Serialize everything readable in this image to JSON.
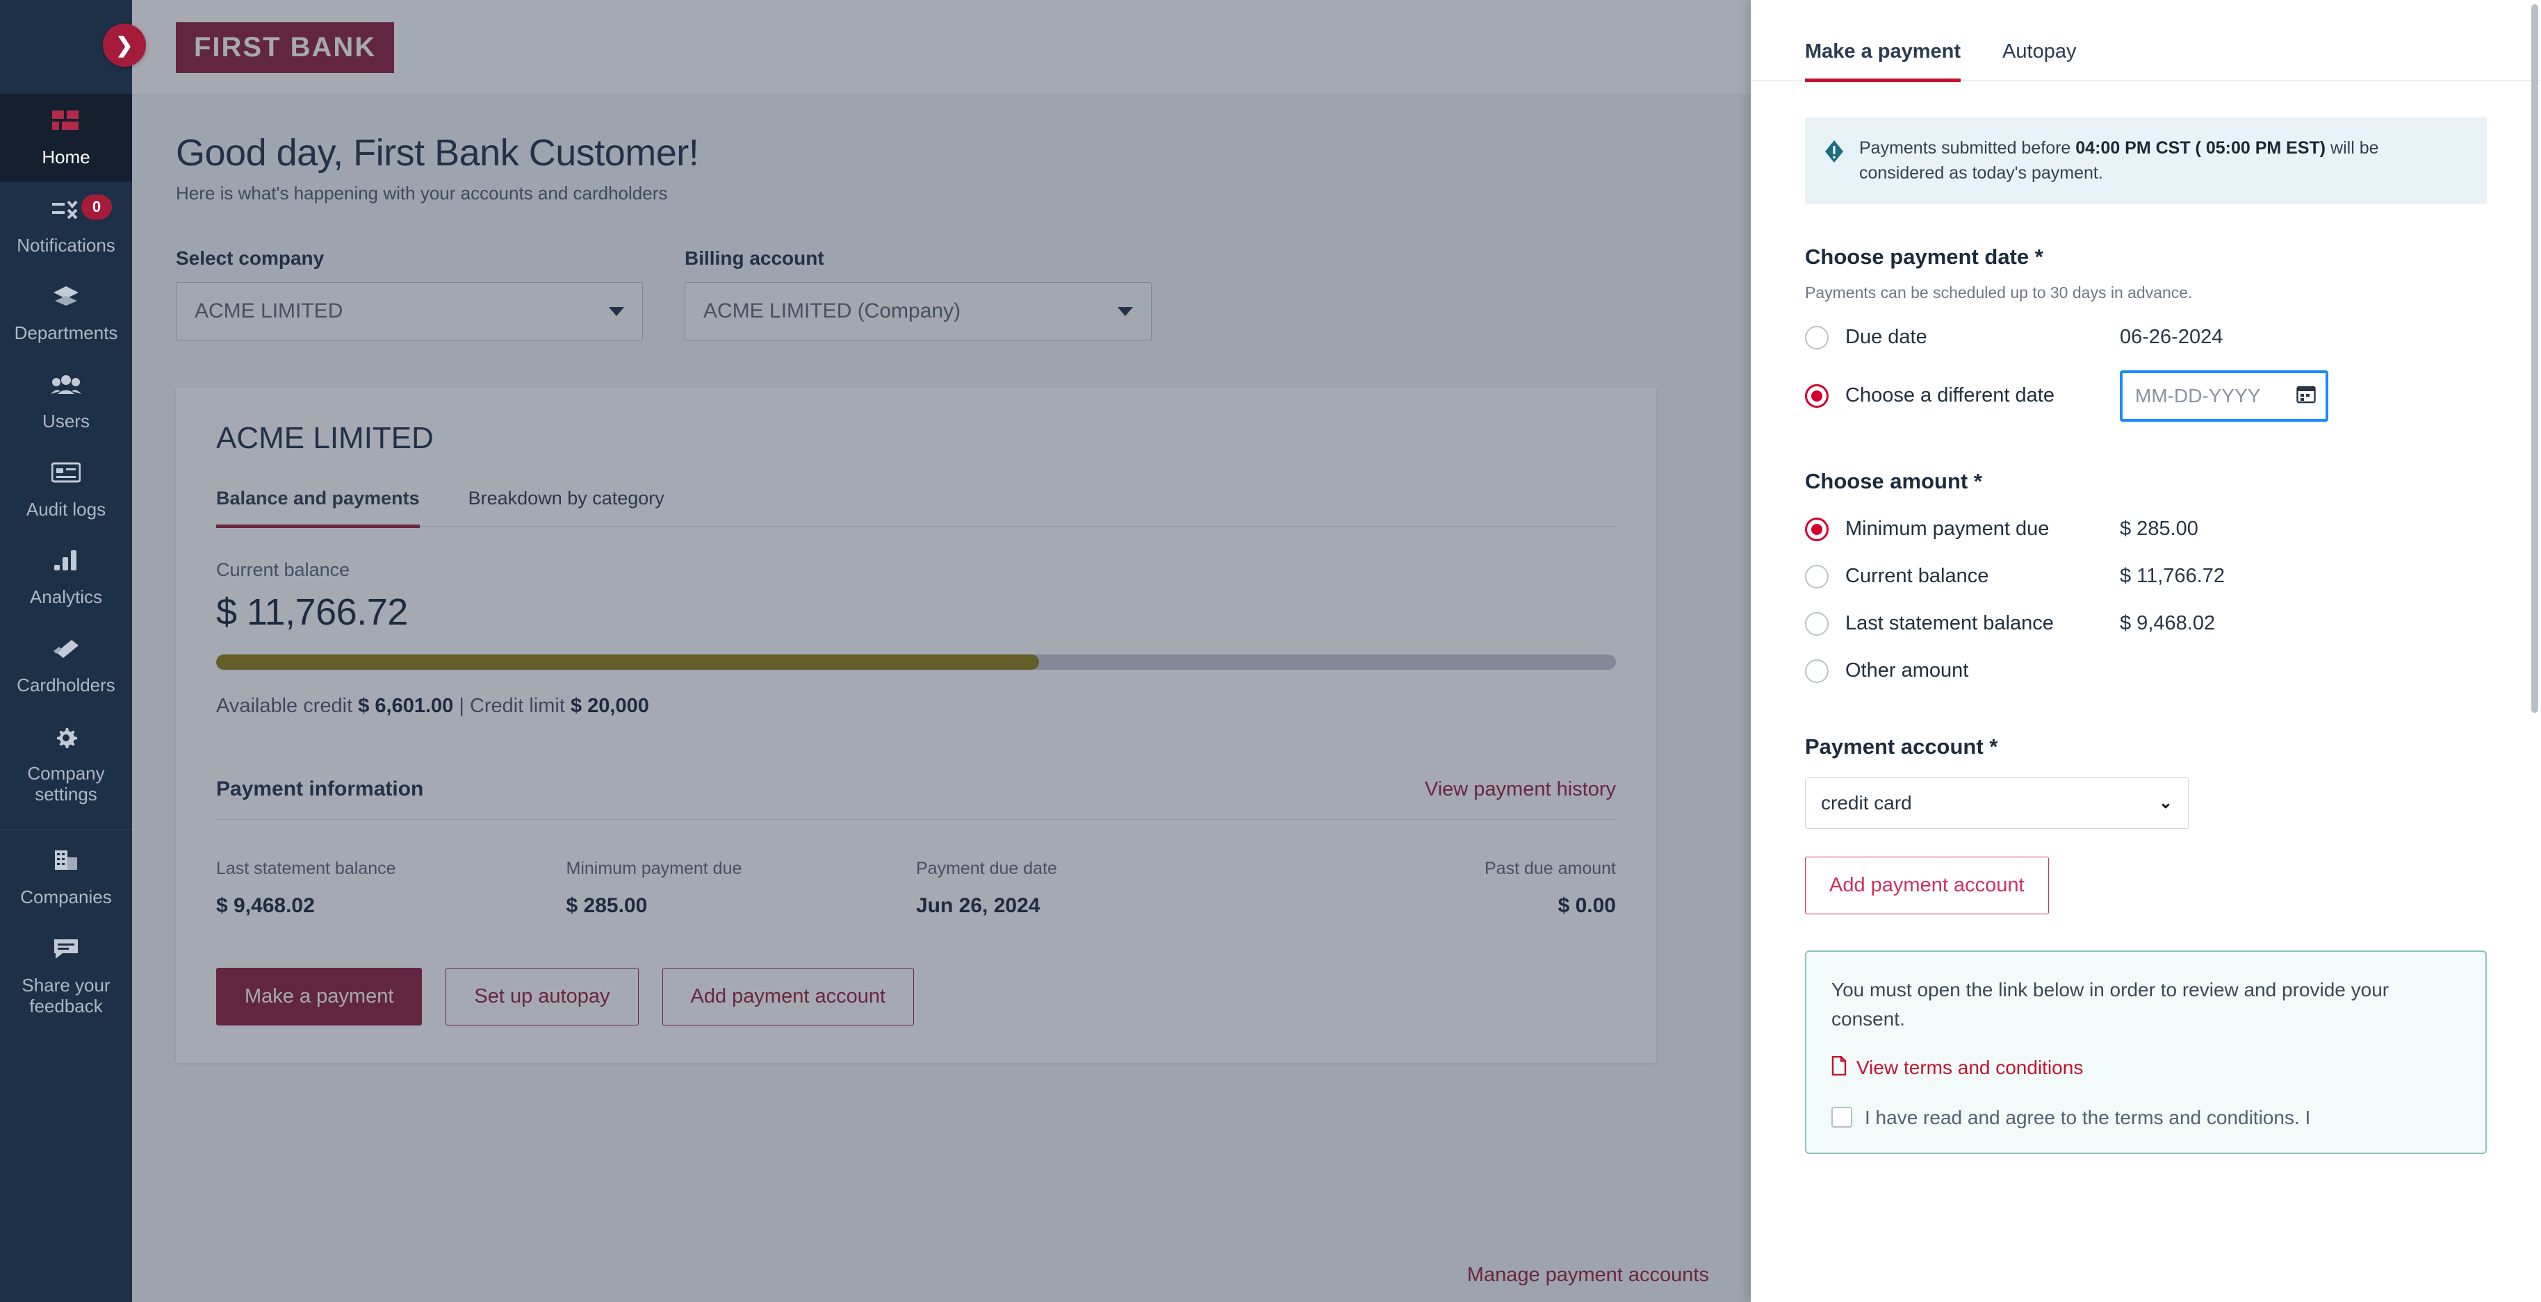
{
  "brand": {
    "logo_text": "FIRST BANK",
    "accent": "#8c1d3c",
    "panel_accent": "#c41230",
    "sidebar_bg": "#1e3048",
    "progress_fill": "#8e7a14"
  },
  "sidebar": {
    "toggle_icon": "chevron-right-icon",
    "items": [
      {
        "label": "Home",
        "icon": "dashboard-grid-icon",
        "active": true,
        "badge": null
      },
      {
        "label": "Notifications",
        "icon": "notifications-list-icon",
        "active": false,
        "badge": "0"
      },
      {
        "label": "Departments",
        "icon": "layers-icon",
        "active": false,
        "badge": null
      },
      {
        "label": "Users",
        "icon": "users-group-icon",
        "active": false,
        "badge": null
      },
      {
        "label": "Audit logs",
        "icon": "audit-log-icon",
        "active": false,
        "badge": null
      },
      {
        "label": "Analytics",
        "icon": "bar-chart-icon",
        "active": false,
        "badge": null
      },
      {
        "label": "Cardholders",
        "icon": "card-icon",
        "active": false,
        "badge": null
      },
      {
        "label": "Company settings",
        "icon": "gear-icon",
        "active": false,
        "badge": null
      },
      {
        "label": "Companies",
        "icon": "building-icon",
        "active": false,
        "badge": null
      },
      {
        "label": "Share your feedback",
        "icon": "feedback-chat-icon",
        "active": false,
        "badge": null
      }
    ]
  },
  "page": {
    "title": "Good day, First Bank Customer!",
    "subtitle": "Here is what's happening with your accounts and cardholders"
  },
  "selectors": {
    "company": {
      "label": "Select company",
      "value": "ACME LIMITED"
    },
    "billing": {
      "label": "Billing account",
      "value": "ACME LIMITED (Company)"
    }
  },
  "account_card": {
    "title": "ACME LIMITED",
    "tabs": [
      {
        "label": "Balance and payments",
        "active": true
      },
      {
        "label": "Breakdown by category",
        "active": false
      }
    ],
    "current_balance_label": "Current balance",
    "current_balance_value": "$ 11,766.72",
    "progress_percent": 58.8,
    "available_credit_label": "Available credit",
    "available_credit_value": "$ 6,601.00",
    "separator": "|",
    "credit_limit_label": "Credit limit",
    "credit_limit_value": "$ 20,000",
    "payment_info_title": "Payment information",
    "view_payment_history": "View payment history",
    "info_columns": [
      {
        "label": "Last statement balance",
        "value": "$ 9,468.02"
      },
      {
        "label": "Minimum payment due",
        "value": "$ 285.00"
      },
      {
        "label": "Payment due date",
        "value": "Jun 26, 2024"
      },
      {
        "label": "Past due amount",
        "value": "$ 0.00"
      }
    ],
    "buttons": [
      {
        "label": "Make a payment",
        "style": "primary"
      },
      {
        "label": "Set up autopay",
        "style": "outline"
      },
      {
        "label": "Add payment account",
        "style": "outline"
      }
    ],
    "manage_link": "Manage payment accounts"
  },
  "panel": {
    "tabs": [
      {
        "label": "Make a payment",
        "active": true
      },
      {
        "label": "Autopay",
        "active": false
      }
    ],
    "notice": {
      "icon": "info-alert-icon",
      "prefix": "Payments submitted before ",
      "bold": "04:00 PM CST ( 05:00 PM EST)",
      "suffix": " will be considered as today's payment."
    },
    "payment_date": {
      "title": "Choose payment date *",
      "hint": "Payments can be scheduled up to 30 days in advance.",
      "options": [
        {
          "label": "Due date",
          "value": "06-26-2024",
          "selected": false,
          "type": "text"
        },
        {
          "label": "Choose a different date",
          "value": "",
          "placeholder": "MM-DD-YYYY",
          "selected": true,
          "type": "date",
          "focused": true,
          "icon": "calendar-icon"
        }
      ]
    },
    "amount": {
      "title": "Choose amount *",
      "options": [
        {
          "label": "Minimum payment due",
          "value": "$ 285.00",
          "selected": true
        },
        {
          "label": "Current balance",
          "value": "$ 11,766.72",
          "selected": false
        },
        {
          "label": "Last statement balance",
          "value": "$ 9,468.02",
          "selected": false
        },
        {
          "label": "Other amount",
          "value": "",
          "selected": false
        }
      ]
    },
    "payment_account": {
      "title": "Payment account *",
      "selected_value": "credit card",
      "dropdown_icon": "chevron-down-icon",
      "add_button": "Add payment account"
    },
    "terms": {
      "message": "You must open the link below in order to review and provide your consent.",
      "link_icon": "document-icon",
      "link_text": "View terms and conditions",
      "checkbox_text": "I have read and agree to the terms and conditions. I",
      "checkbox_checked": false
    }
  }
}
